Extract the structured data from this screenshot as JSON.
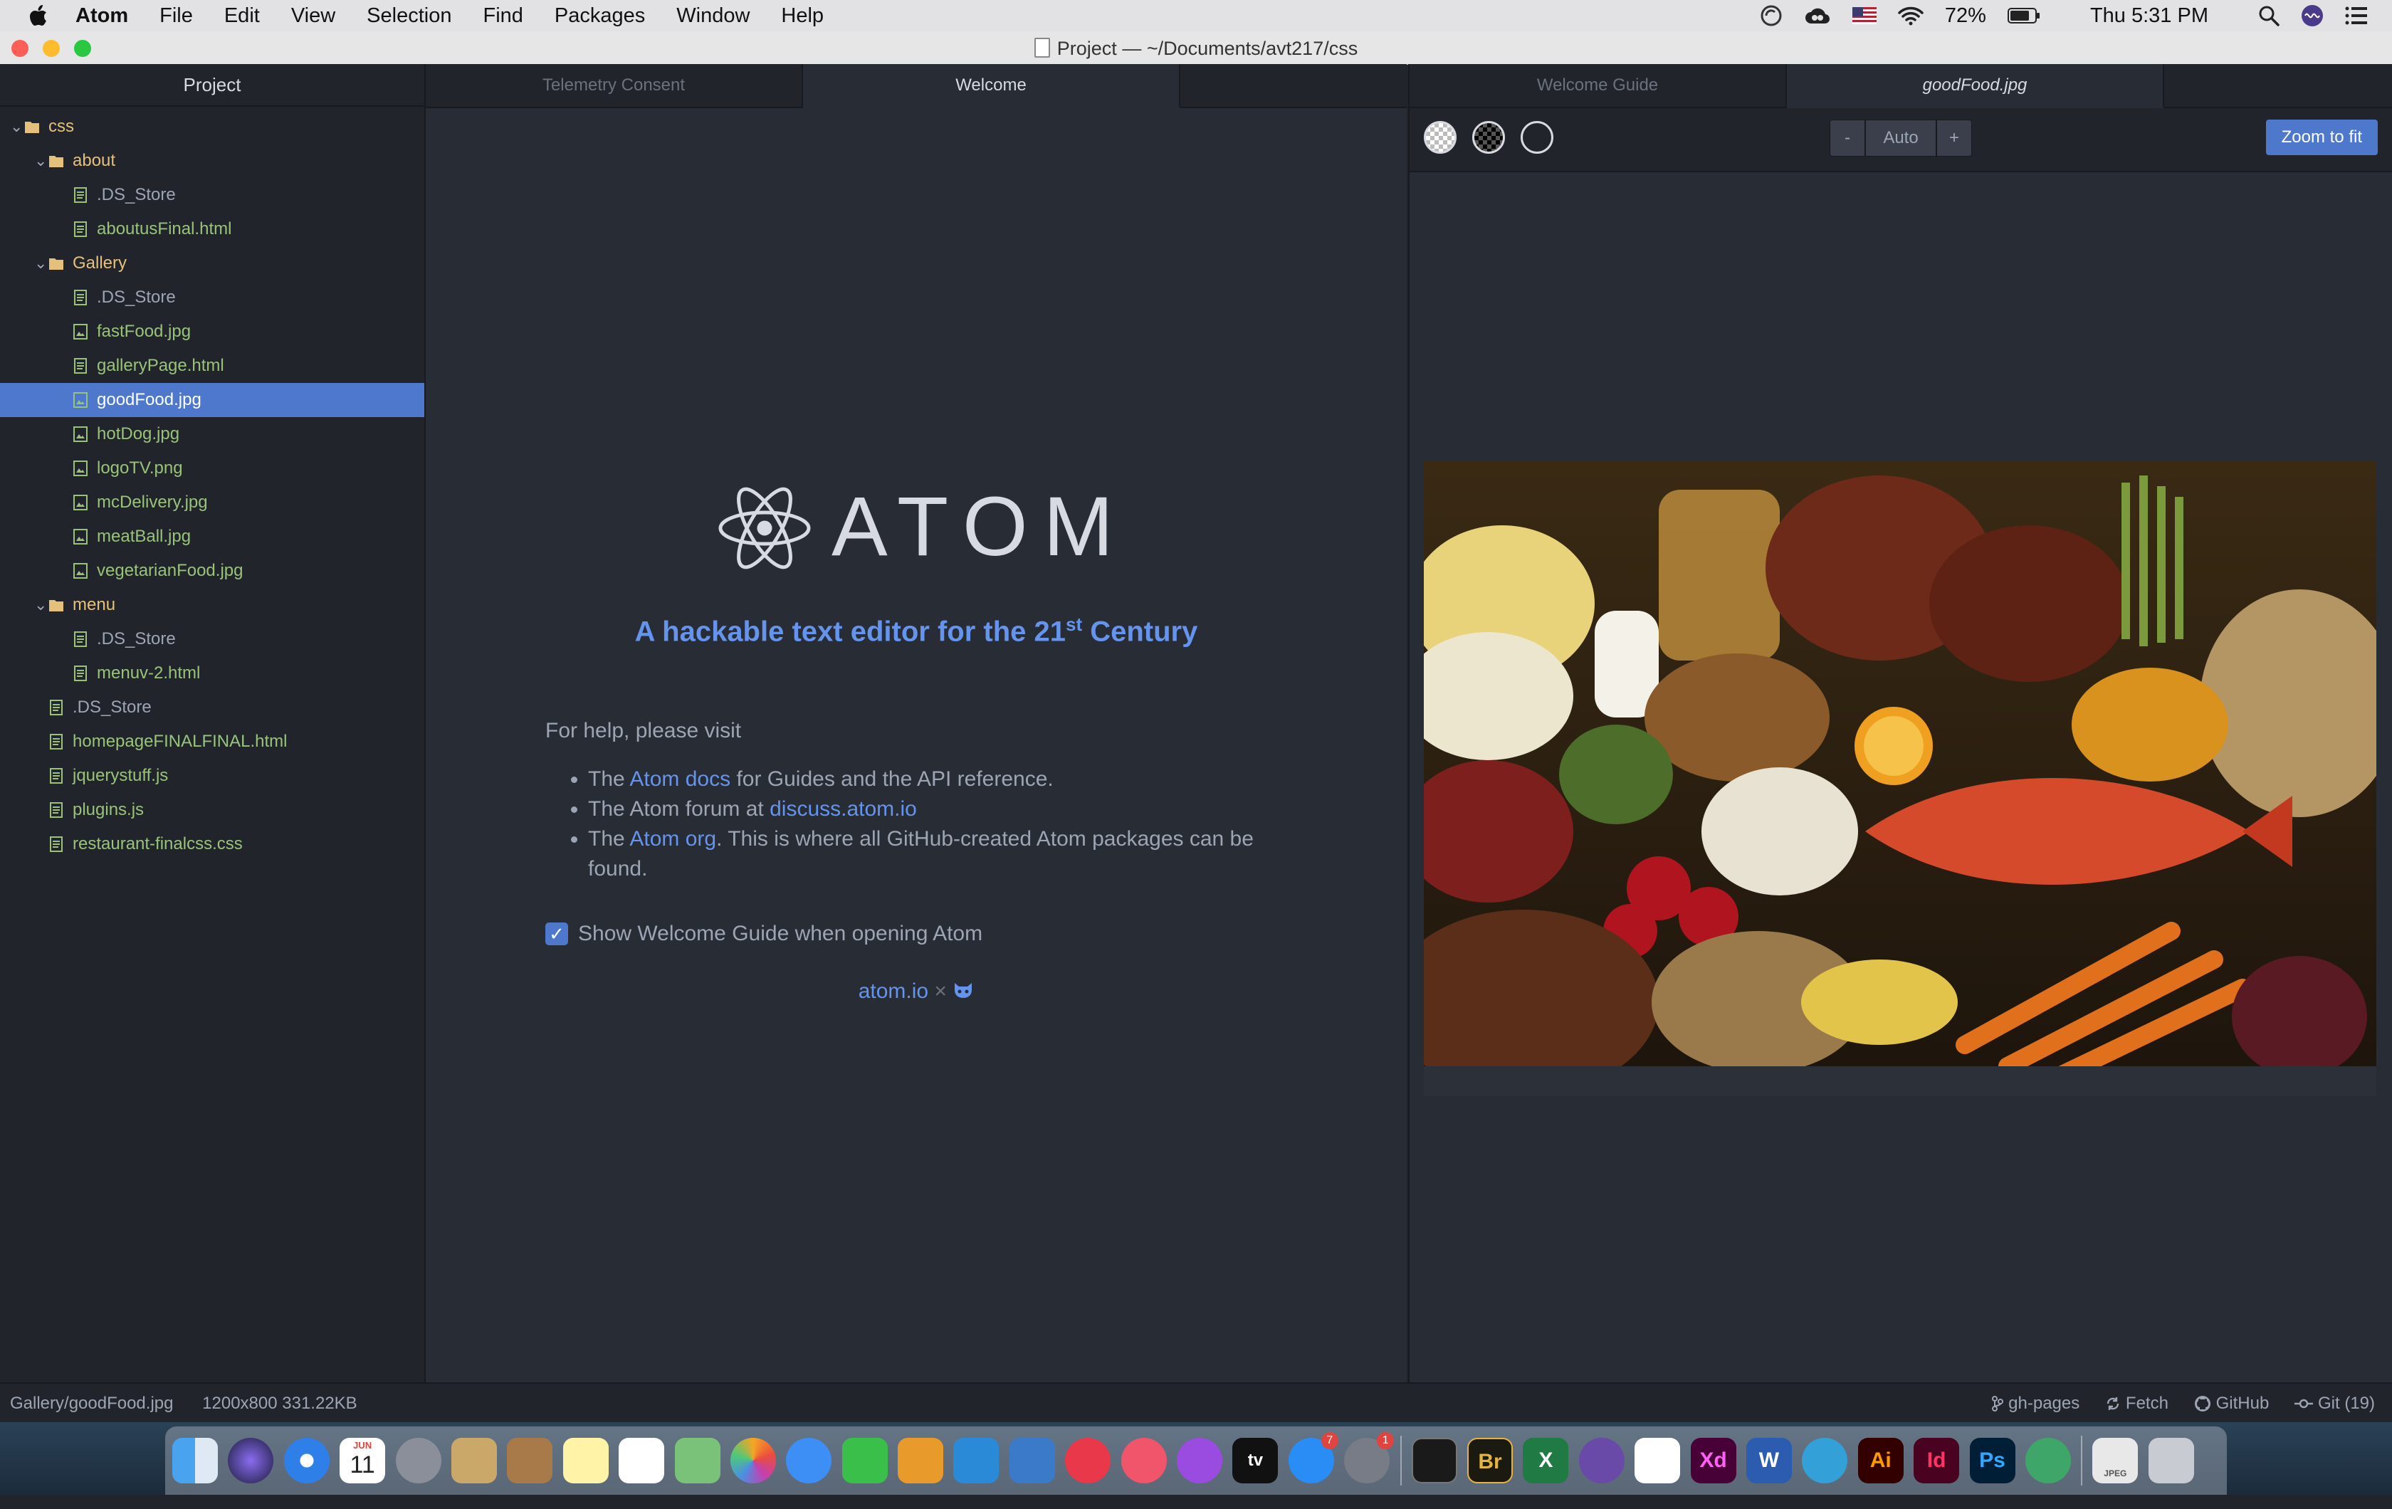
{
  "menubar": {
    "items": [
      "Atom",
      "File",
      "Edit",
      "View",
      "Selection",
      "Find",
      "Packages",
      "Window",
      "Help"
    ],
    "battery": "72%",
    "clock": "Thu 5:31 PM"
  },
  "window": {
    "title": "Project — ~/Documents/avt217/css"
  },
  "tree": {
    "title": "Project",
    "rows": [
      {
        "label": "css",
        "type": "dir",
        "depth": 0
      },
      {
        "label": "about",
        "type": "dir",
        "depth": 1
      },
      {
        "label": ".DS_Store",
        "type": "file",
        "depth": 2
      },
      {
        "label": "aboutusFinal.html",
        "type": "file",
        "depth": 2
      },
      {
        "label": "Gallery",
        "type": "dir",
        "depth": 1
      },
      {
        "label": ".DS_Store",
        "type": "file",
        "depth": 2
      },
      {
        "label": "fastFood.jpg",
        "type": "image",
        "depth": 2
      },
      {
        "label": "galleryPage.html",
        "type": "file",
        "depth": 2
      },
      {
        "label": "goodFood.jpg",
        "type": "image",
        "depth": 2,
        "selected": true
      },
      {
        "label": "hotDog.jpg",
        "type": "image",
        "depth": 2
      },
      {
        "label": "logoTV.png",
        "type": "image",
        "depth": 2
      },
      {
        "label": "mcDelivery.jpg",
        "type": "image",
        "depth": 2
      },
      {
        "label": "meatBall.jpg",
        "type": "image",
        "depth": 2
      },
      {
        "label": "vegetarianFood.jpg",
        "type": "image",
        "depth": 2
      },
      {
        "label": "menu",
        "type": "dir",
        "depth": 1
      },
      {
        "label": ".DS_Store",
        "type": "file",
        "depth": 2
      },
      {
        "label": "menuv-2.html",
        "type": "file",
        "depth": 2
      },
      {
        "label": ".DS_Store",
        "type": "file",
        "depth": 1
      },
      {
        "label": "homepageFINALFINAL.html",
        "type": "file",
        "depth": 1
      },
      {
        "label": "jquerystuff.js",
        "type": "file",
        "depth": 1
      },
      {
        "label": "plugins.js",
        "type": "file",
        "depth": 1
      },
      {
        "label": "restaurant-finalcss.css",
        "type": "file",
        "depth": 1
      }
    ]
  },
  "tabs": {
    "left": [
      "Telemetry Consent",
      "Welcome"
    ],
    "right": [
      "Welcome Guide",
      "goodFood.jpg"
    ]
  },
  "welcome": {
    "logo_text": "ATOM",
    "tagline_pre": "A hackable text editor for the 21",
    "tagline_sup": "st",
    "tagline_post": " Century",
    "help_intro": "For help, please visit",
    "b1_pre": "The ",
    "b1_link": "Atom docs",
    "b1_post": " for Guides and the API reference.",
    "b2_pre": "The Atom forum at ",
    "b2_link": "discuss.atom.io",
    "b3_pre": "The ",
    "b3_link": "Atom org",
    "b3_post": ". This is where all GitHub-created Atom packages can be found.",
    "checkbox_label": "Show Welcome Guide when opening Atom",
    "checkbox_checked": true,
    "footer_link": "atom.io",
    "footer_sep": "×"
  },
  "image_view": {
    "zoom_minus": "-",
    "zoom_value": "Auto",
    "zoom_plus": "+",
    "zoom_fit": "Zoom to fit"
  },
  "status": {
    "path": "Gallery/goodFood.jpg",
    "info": "1200x800 331.22KB",
    "branch": "gh-pages",
    "fetch": "Fetch",
    "github": "GitHub",
    "git": "Git (19)"
  },
  "dock": {
    "calendar_month": "JUN",
    "calendar_day": "11",
    "appletv": "tv",
    "badge_appstore": "7",
    "badge_prefs": "1",
    "bridge": "Br",
    "excel": "X",
    "xd": "Xd",
    "word": "W",
    "illustrator": "Ai",
    "indesign": "Id",
    "photoshop": "Ps",
    "file_label": "JPEG"
  },
  "colors": {
    "accent": "#4d78cc",
    "link": "#6494ed",
    "tree_file": "#98c379",
    "tree_dir": "#e5c07b"
  }
}
